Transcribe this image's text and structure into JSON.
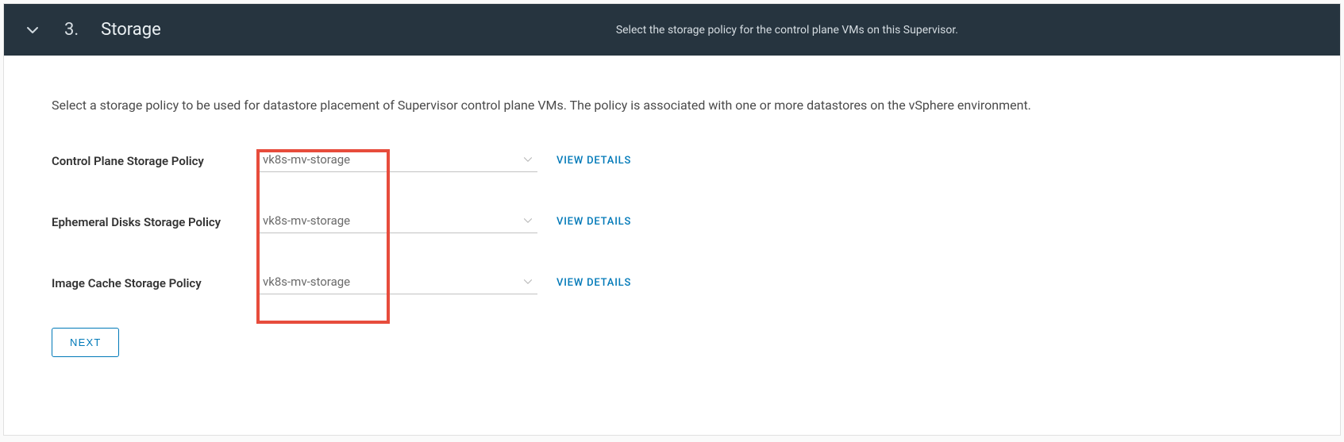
{
  "header": {
    "step_number": "3.",
    "step_title": "Storage",
    "subtitle": "Select the storage policy for the control plane VMs on this Supervisor."
  },
  "content": {
    "description": "Select a storage policy to be used for datastore placement of Supervisor control plane VMs. The policy is associated with one or more datastores on the vSphere environment."
  },
  "fields": {
    "control_plane": {
      "label": "Control Plane Storage Policy",
      "value": "vk8s-mv-storage",
      "details_link": "VIEW DETAILS"
    },
    "ephemeral": {
      "label": "Ephemeral Disks Storage Policy",
      "value": "vk8s-mv-storage",
      "details_link": "VIEW DETAILS"
    },
    "image_cache": {
      "label": "Image Cache Storage Policy",
      "value": "vk8s-mv-storage",
      "details_link": "VIEW DETAILS"
    }
  },
  "actions": {
    "next_label": "NEXT"
  }
}
